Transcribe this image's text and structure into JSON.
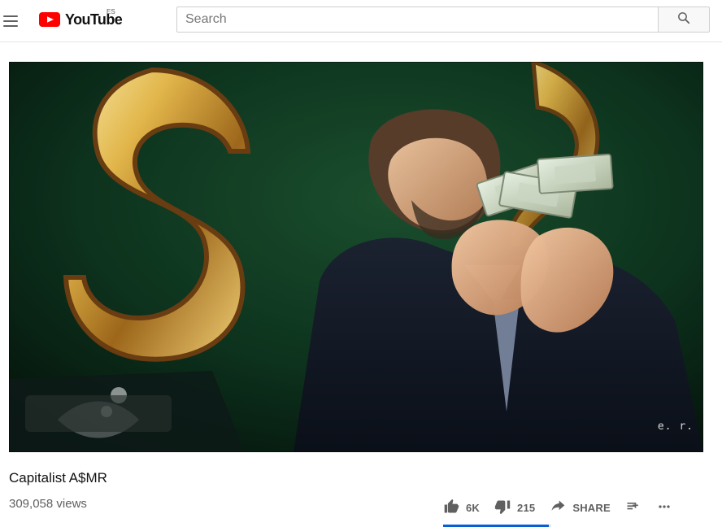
{
  "header": {
    "logo_text": "YouTube",
    "country_code": "ES",
    "search_placeholder": "Search",
    "search_value": "",
    "icons": {
      "menu": "hamburger-menu-icon",
      "logo": "youtube-play-icon",
      "search": "search-icon"
    }
  },
  "video": {
    "watermark": "e. r.",
    "title": "Capitalist A$MR",
    "views": "309,058 views"
  },
  "actions": {
    "like_count": "6K",
    "dislike_count": "215",
    "share_label": "SHARE",
    "icons": {
      "like": "thumbs-up-icon",
      "dislike": "thumbs-down-icon",
      "share": "share-arrow-icon",
      "save": "add-to-playlist-icon",
      "more": "more-horiz-icon"
    }
  },
  "colors": {
    "brand": "#ff0000",
    "accent": "#065fd4"
  }
}
